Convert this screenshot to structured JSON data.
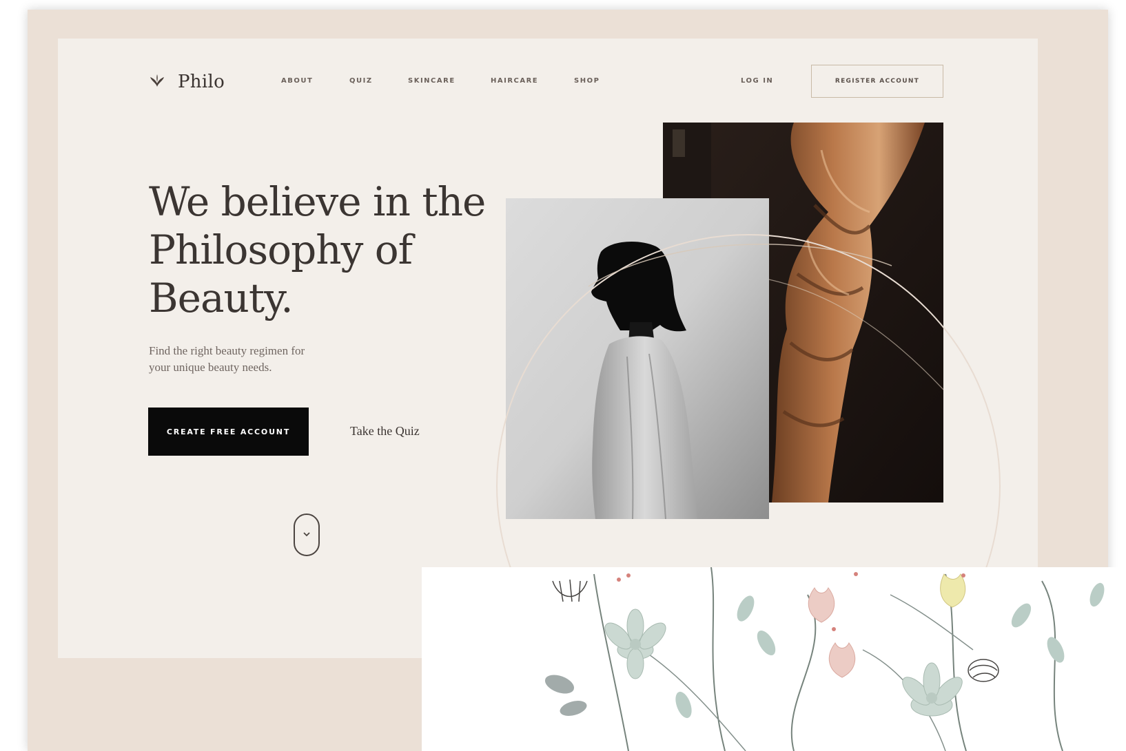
{
  "brand": {
    "name": "Philo",
    "logo_icon": "leaf-crown-icon"
  },
  "nav": {
    "links": [
      "ABOUT",
      "QUIZ",
      "SKINCARE",
      "HAIRCARE",
      "SHOP"
    ],
    "login": "LOG IN",
    "register": "REGISTER ACCOUNT"
  },
  "hero": {
    "headline_line1": "We believe in the",
    "headline_line2": "Philosophy of",
    "headline_line3": "Beauty.",
    "subtext_line1": "Find the right beauty regimen for",
    "subtext_line2": "your unique beauty needs.",
    "cta": "CREATE FREE ACCOUNT",
    "quiz_link": "Take the Quiz",
    "scroll_icon": "chevron-down-icon"
  },
  "colors": {
    "frame": "#ebe0d6",
    "page": "#f3efea",
    "text": "#3b3532",
    "cta_bg": "#0a0a0a",
    "border": "#c8b9a6"
  }
}
